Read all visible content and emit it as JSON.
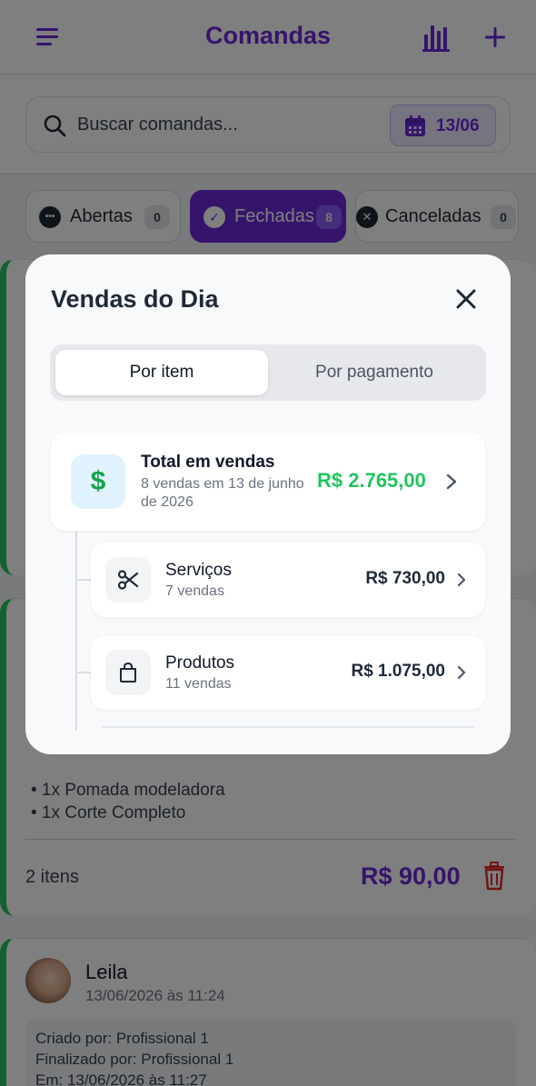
{
  "header": {
    "title": "Comandas",
    "icons": [
      "menu-icon",
      "bar-chart-icon",
      "plus-icon"
    ]
  },
  "search": {
    "placeholder": "Buscar comandas...",
    "date_label": "13/06"
  },
  "filters": [
    {
      "label": "Abertas",
      "count": "0",
      "icon": "•••"
    },
    {
      "label": "Fechadas",
      "count": "8",
      "icon": "✓",
      "active": true
    },
    {
      "label": "Canceladas",
      "count": "0",
      "icon": "✕"
    }
  ],
  "card1": {
    "items": [
      "• 1x Pomada modeladora",
      "• 1x Corte Completo"
    ],
    "items_count": "2 itens",
    "total": "R$ 90,00"
  },
  "card2": {
    "customer": "Leila",
    "date": "13/06/2026 às 11:24",
    "info": [
      "Criado por: Profissional 1",
      "Finalizado por: Profissional 1",
      "Em: 13/06/2026 às 11:27"
    ]
  },
  "modal": {
    "title": "Vendas do Dia",
    "tabs": {
      "active": "Por item",
      "inactive": "Por pagamento"
    },
    "total": {
      "label": "Total em vendas",
      "sub_line1": "8 vendas em 13 de junho",
      "sub_line2": "de 2026",
      "value": "R$ 2.765,00",
      "icon": "$"
    },
    "rows": [
      {
        "label": "Serviços",
        "sub": "7 vendas",
        "value": "R$ 730,00",
        "icon": "scissors-icon"
      },
      {
        "label": "Produtos",
        "sub": "11 vendas",
        "value": "R$ 1.075,00",
        "icon": "shopping-bag-icon"
      }
    ]
  },
  "colors": {
    "accent": "#6d28d9",
    "success": "#22c55e",
    "danger": "#dc2626"
  }
}
